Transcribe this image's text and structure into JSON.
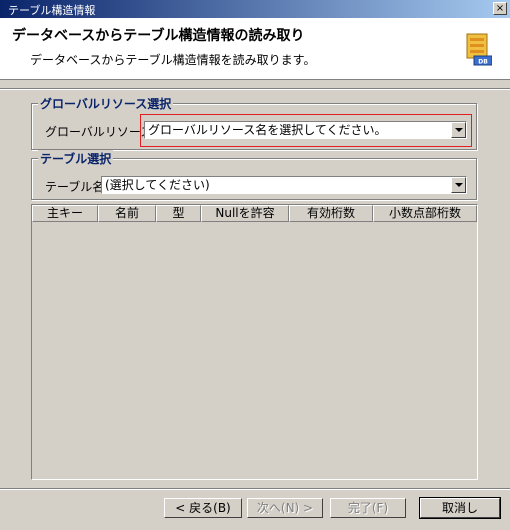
{
  "window": {
    "title": "テーブル構造情報",
    "close_label": "×"
  },
  "header": {
    "title": "データベースからテーブル構造情報の読み取り",
    "description": "データベースからテーブル構造情報を読み取ります。",
    "icon": "database-icon",
    "icon_label": "DB"
  },
  "global_resource": {
    "legend": "グローバルリソース選択",
    "label": "グローバルリソース名",
    "selected": "グローバルリソース名を選択してください。"
  },
  "table_select": {
    "legend": "テーブル選択",
    "label": "テーブル名",
    "selected": "(選択してください)"
  },
  "columns_table": {
    "headers": [
      "主キー",
      "名前",
      "型",
      "Nullを許容",
      "有効桁数",
      "小数点部桁数"
    ]
  },
  "buttons": {
    "back": "< 戻る(B)",
    "next": "次へ(N) >",
    "finish": "完了(F)",
    "cancel": "取消し"
  },
  "colors": {
    "title_bar": "#0a246a",
    "legend_text": "#0a246a",
    "highlight": "#e02020",
    "face": "#d4d0c8"
  }
}
